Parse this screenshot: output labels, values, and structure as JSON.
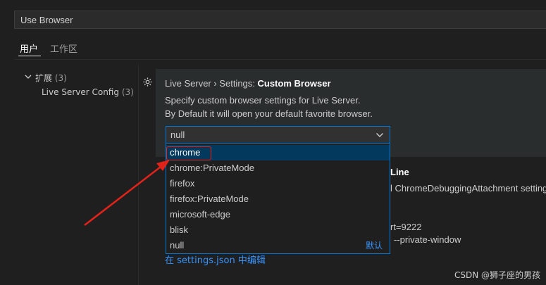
{
  "search": {
    "value": "Use Browser"
  },
  "tabs": [
    {
      "label": "用户"
    },
    {
      "label": "工作区"
    }
  ],
  "tree": {
    "group_label": "扩展",
    "group_count": "(3)",
    "child_label": "Live Server Config",
    "child_count": "(3)"
  },
  "setting": {
    "prefix": "Live Server › Settings: ",
    "name": "Custom Browser",
    "desc_line1": "Specify custom browser settings for Live Server.",
    "desc_line2": "By Default it will open your default favorite browser.",
    "current_value": "null",
    "options": [
      "chrome",
      "chrome:PrivateMode",
      "firefox",
      "firefox:PrivateMode",
      "microsoft-edge",
      "blisk",
      "null"
    ],
    "default_tag": "默认"
  },
  "background": {
    "title_fragment": "Line",
    "text_fragment": "l ChromeDebuggingAttachment setting",
    "port_fragment": "rt=9222",
    "private_fragment": "--private-window"
  },
  "edit_link": "在 settings.json 中编辑",
  "watermark": "CSDN @狮子座的男孩",
  "colors": {
    "accent": "#0078d4",
    "highlight": "#e2231a"
  }
}
